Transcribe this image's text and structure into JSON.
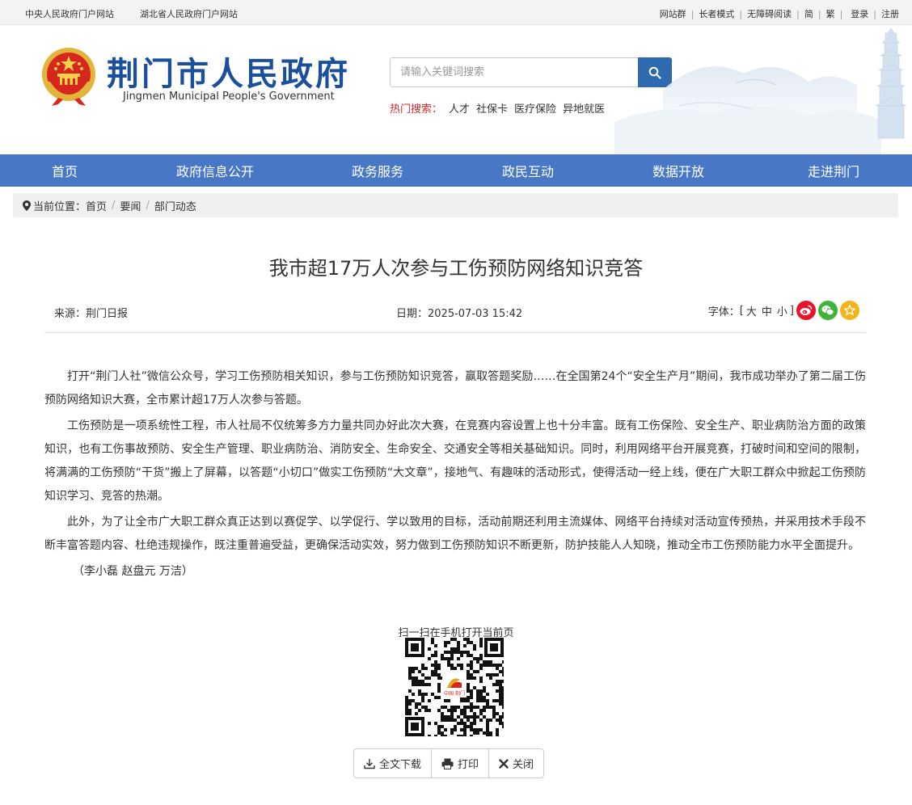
{
  "topbar": {
    "left_links": [
      "中央人民政府门户网站",
      "湖北省人民政府门户网站"
    ],
    "right_links": [
      "网站群",
      "长者模式",
      "无障碍阅读",
      "简",
      "繁",
      "登录",
      "注册"
    ]
  },
  "header": {
    "site_name": "荆门市人民政府",
    "site_name_en": "Jingmen Municipal People's Government",
    "search_placeholder": "请输入关键词搜索",
    "hot_label": "热门搜索：",
    "hot_terms": [
      "人才",
      "社保卡",
      "医疗保险",
      "异地就医"
    ]
  },
  "nav": {
    "items": [
      "首页",
      "政府信息公开",
      "政务服务",
      "政民互动",
      "数据开放",
      "走进荆门"
    ]
  },
  "breadcrumb": {
    "label": "当前位置：",
    "items": [
      "首页",
      "要闻",
      "部门动态"
    ]
  },
  "article": {
    "title": "我市超17万人次参与工伤预防网络知识竞答",
    "source": "来源：荆门日报",
    "date": "日期：2025-07-03 15:42",
    "font_label": "字体：",
    "font_bracket_open": "[",
    "font_sizes": [
      "大",
      "中",
      "小"
    ],
    "font_bracket_close": "]",
    "paragraphs": [
      "打开“荆门人社”微信公众号，学习工伤预防相关知识，参与工伤预防知识竞答，赢取答题奖励……在全国第24个“安全生产月”期间，我市成功举办了第二届工伤预防网络知识大赛，全市累计超17万人次参与答题。",
      "工伤预防是一项系统性工程，市人社局不仅统筹多方力量共同办好此次大赛，在竞赛内容设置上也十分丰富。既有工伤保险、安全生产、职业病防治方面的政策知识，也有工伤事故预防、安全生产管理、职业病防治、消防安全、生命安全、交通安全等相关基础知识。同时，利用网络平台开展竞赛，打破时间和空间的限制，将满满的工伤预防“干货”搬上了屏幕，以答题“小切口”做实工伤预防“大文章”，接地气、有趣味的活动形式，使得活动一经上线，便在广大职工群众中掀起工伤预防知识学习、竞答的热潮。",
      "此外，为了让全市广大职工群众真正达到以赛促学、以学促行、学以致用的目标，活动前期还利用主流媒体、网络平台持续对活动宣传预热，并采用技术手段不断丰富答题内容、杜绝违规操作，既注重普遍受益，更确保活动实效，努力做到工伤预防知识不断更新，防护技能人人知晓，推动全市工伤预防能力水平全面提升。"
    ],
    "author": "（李小磊 赵盘元 万洁）"
  },
  "qr": {
    "label": "扫一扫在手机打开当前页",
    "logo_text": "中国·荆门"
  },
  "actions": {
    "download": "全文下载",
    "print": "打印",
    "close": "关闭"
  },
  "colors": {
    "nav_bg": "#4877c5",
    "brand_blue": "#1a4f9c",
    "search_btn": "#2e6ab0",
    "hot_label": "#d42b2b",
    "weibo": "#e6162d",
    "wechat": "#3fb33b",
    "favorite": "#f2b51c"
  }
}
